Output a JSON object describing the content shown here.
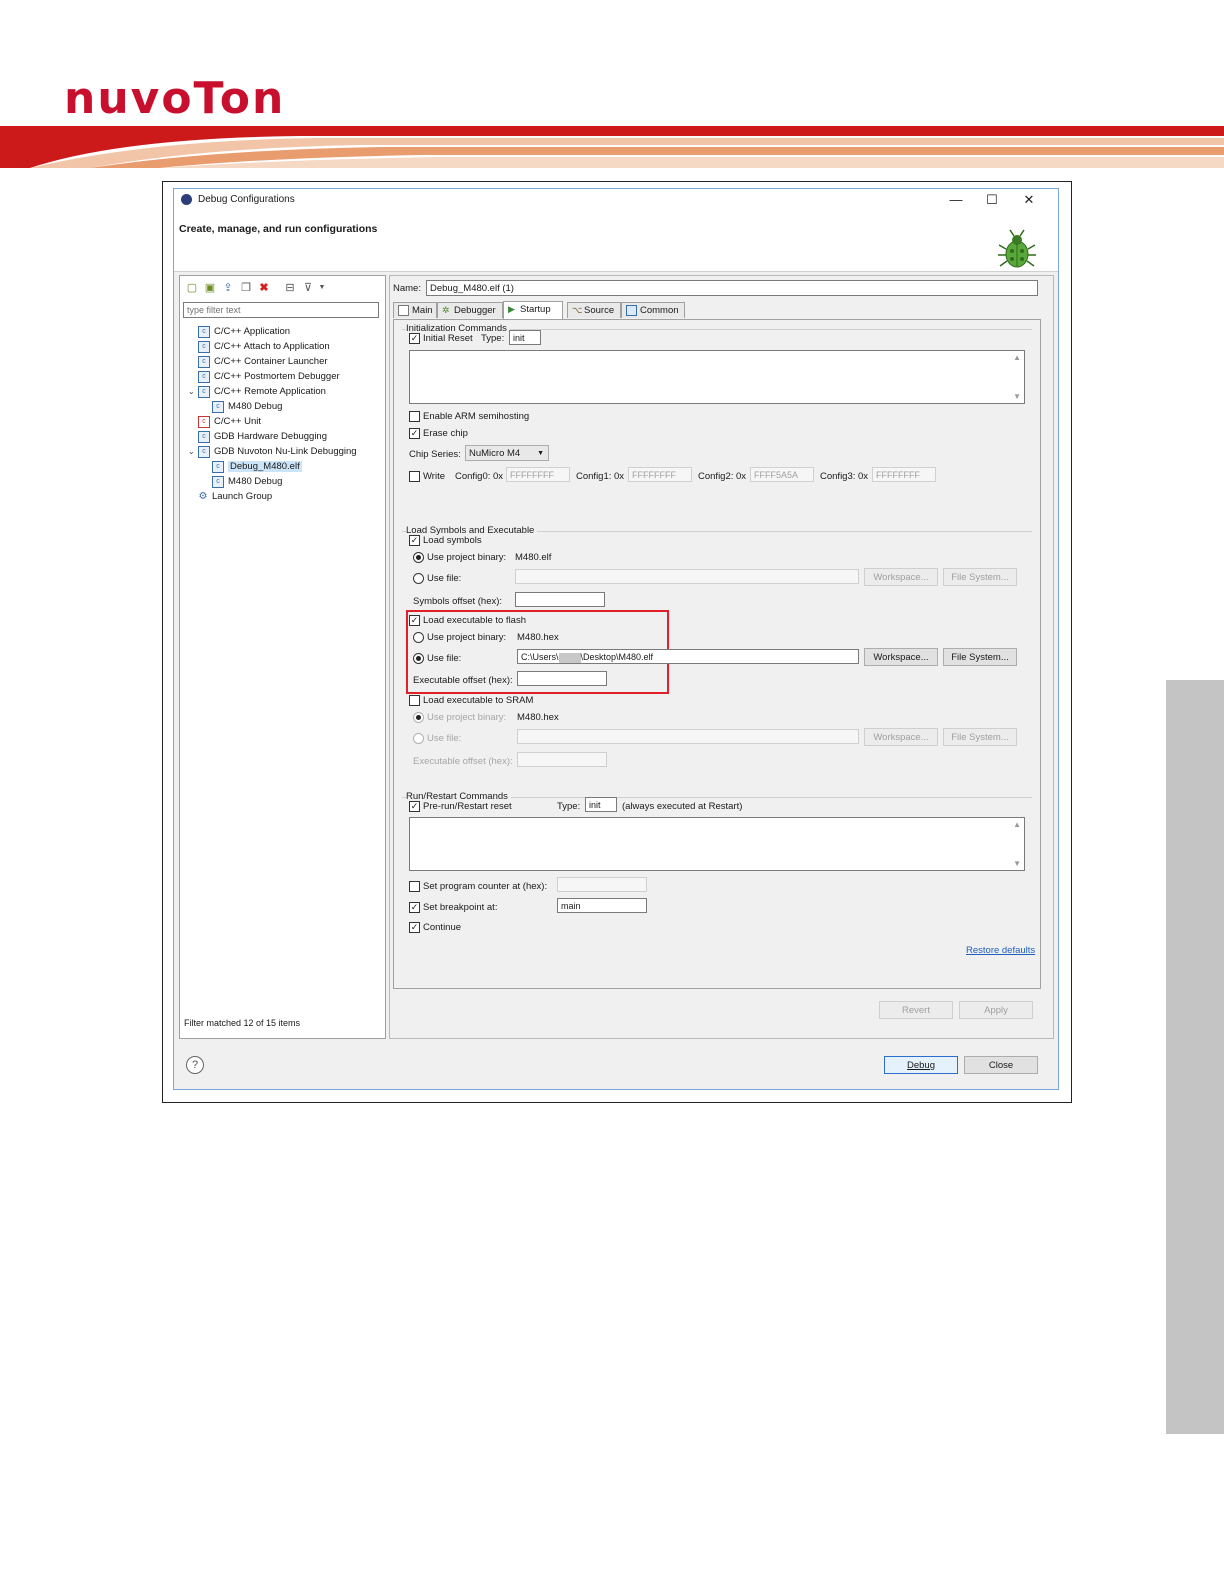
{
  "brand": {
    "logo_text": "nuvoTon"
  },
  "dialog": {
    "title": "Debug Configurations",
    "header": "Create, manage, and run configurations",
    "window_buttons": {
      "minimize": "—",
      "maximize": "☐",
      "close": "✕"
    }
  },
  "left": {
    "filter_placeholder": "type filter text",
    "tree": [
      {
        "label": "C/C++ Application",
        "level": 0
      },
      {
        "label": "C/C++ Attach to Application",
        "level": 0
      },
      {
        "label": "C/C++ Container Launcher",
        "level": 0
      },
      {
        "label": "C/C++ Postmortem Debugger",
        "level": 0
      },
      {
        "label": "C/C++ Remote Application",
        "level": 0,
        "expanded": true
      },
      {
        "label": "M480 Debug",
        "level": 1
      },
      {
        "label": "C/C++ Unit",
        "level": 0
      },
      {
        "label": "GDB Hardware Debugging",
        "level": 0
      },
      {
        "label": "GDB Nuvoton Nu-Link Debugging",
        "level": 0,
        "expanded": true
      },
      {
        "label": "Debug_M480.elf",
        "level": 1,
        "selected": true
      },
      {
        "label": "M480 Debug",
        "level": 1
      },
      {
        "label": "Launch Group",
        "level": 0
      }
    ],
    "status": "Filter matched 12 of 15 items"
  },
  "right": {
    "name_label": "Name:",
    "name_value": "Debug_M480.elf (1)",
    "tabs": [
      "Main",
      "Debugger",
      "Startup",
      "Source",
      "Common"
    ],
    "active_tab": "Startup",
    "init": {
      "title": "Initialization Commands",
      "initial_reset": "Initial Reset",
      "type_label": "Type:",
      "type_value": "init",
      "enable_semihosting": "Enable ARM semihosting",
      "erase_chip": "Erase chip",
      "chip_series_label": "Chip Series:",
      "chip_series_value": "NuMicro M4",
      "write": "Write",
      "config0_label": "Config0: 0x",
      "config0_value": "FFFFFFFF",
      "config1_label": "Config1: 0x",
      "config1_value": "FFFFFFFF",
      "config2_label": "Config2: 0x",
      "config2_value": "FFFF5A5A",
      "config3_label": "Config3: 0x",
      "config3_value": "FFFFFFFF"
    },
    "load": {
      "title": "Load Symbols and Executable",
      "load_symbols": "Load symbols",
      "use_project_binary": "Use project binary:",
      "symbols_binary": "M480.elf",
      "use_file": "Use file:",
      "workspace_btn": "Workspace...",
      "filesystem_btn": "File System...",
      "symbols_offset": "Symbols offset (hex):",
      "load_exec_flash": "Load executable to flash",
      "flash_binary": "M480.hex",
      "flash_file_prefix": "C:\\Users\\",
      "flash_file_suffix": "\\Desktop\\M480.elf",
      "exec_offset": "Executable offset (hex):",
      "load_exec_sram": "Load executable to SRAM",
      "sram_binary": "M480.hex"
    },
    "run": {
      "title": "Run/Restart Commands",
      "pre_run": "Pre-run/Restart reset",
      "type_label": "Type:",
      "type_value": "init",
      "type_note": "(always executed at Restart)",
      "set_pc": "Set program counter at (hex):",
      "set_bp": "Set breakpoint at:",
      "bp_value": "main",
      "continue": "Continue"
    },
    "restore_defaults": "Restore defaults",
    "revert": "Revert",
    "apply": "Apply"
  },
  "footer": {
    "help": "?",
    "debug": "Debug",
    "close": "Close"
  },
  "colors": {
    "brand_red": "#c8102e",
    "accent_orange": "#e9a07a",
    "selection_red": "#e0202a"
  }
}
